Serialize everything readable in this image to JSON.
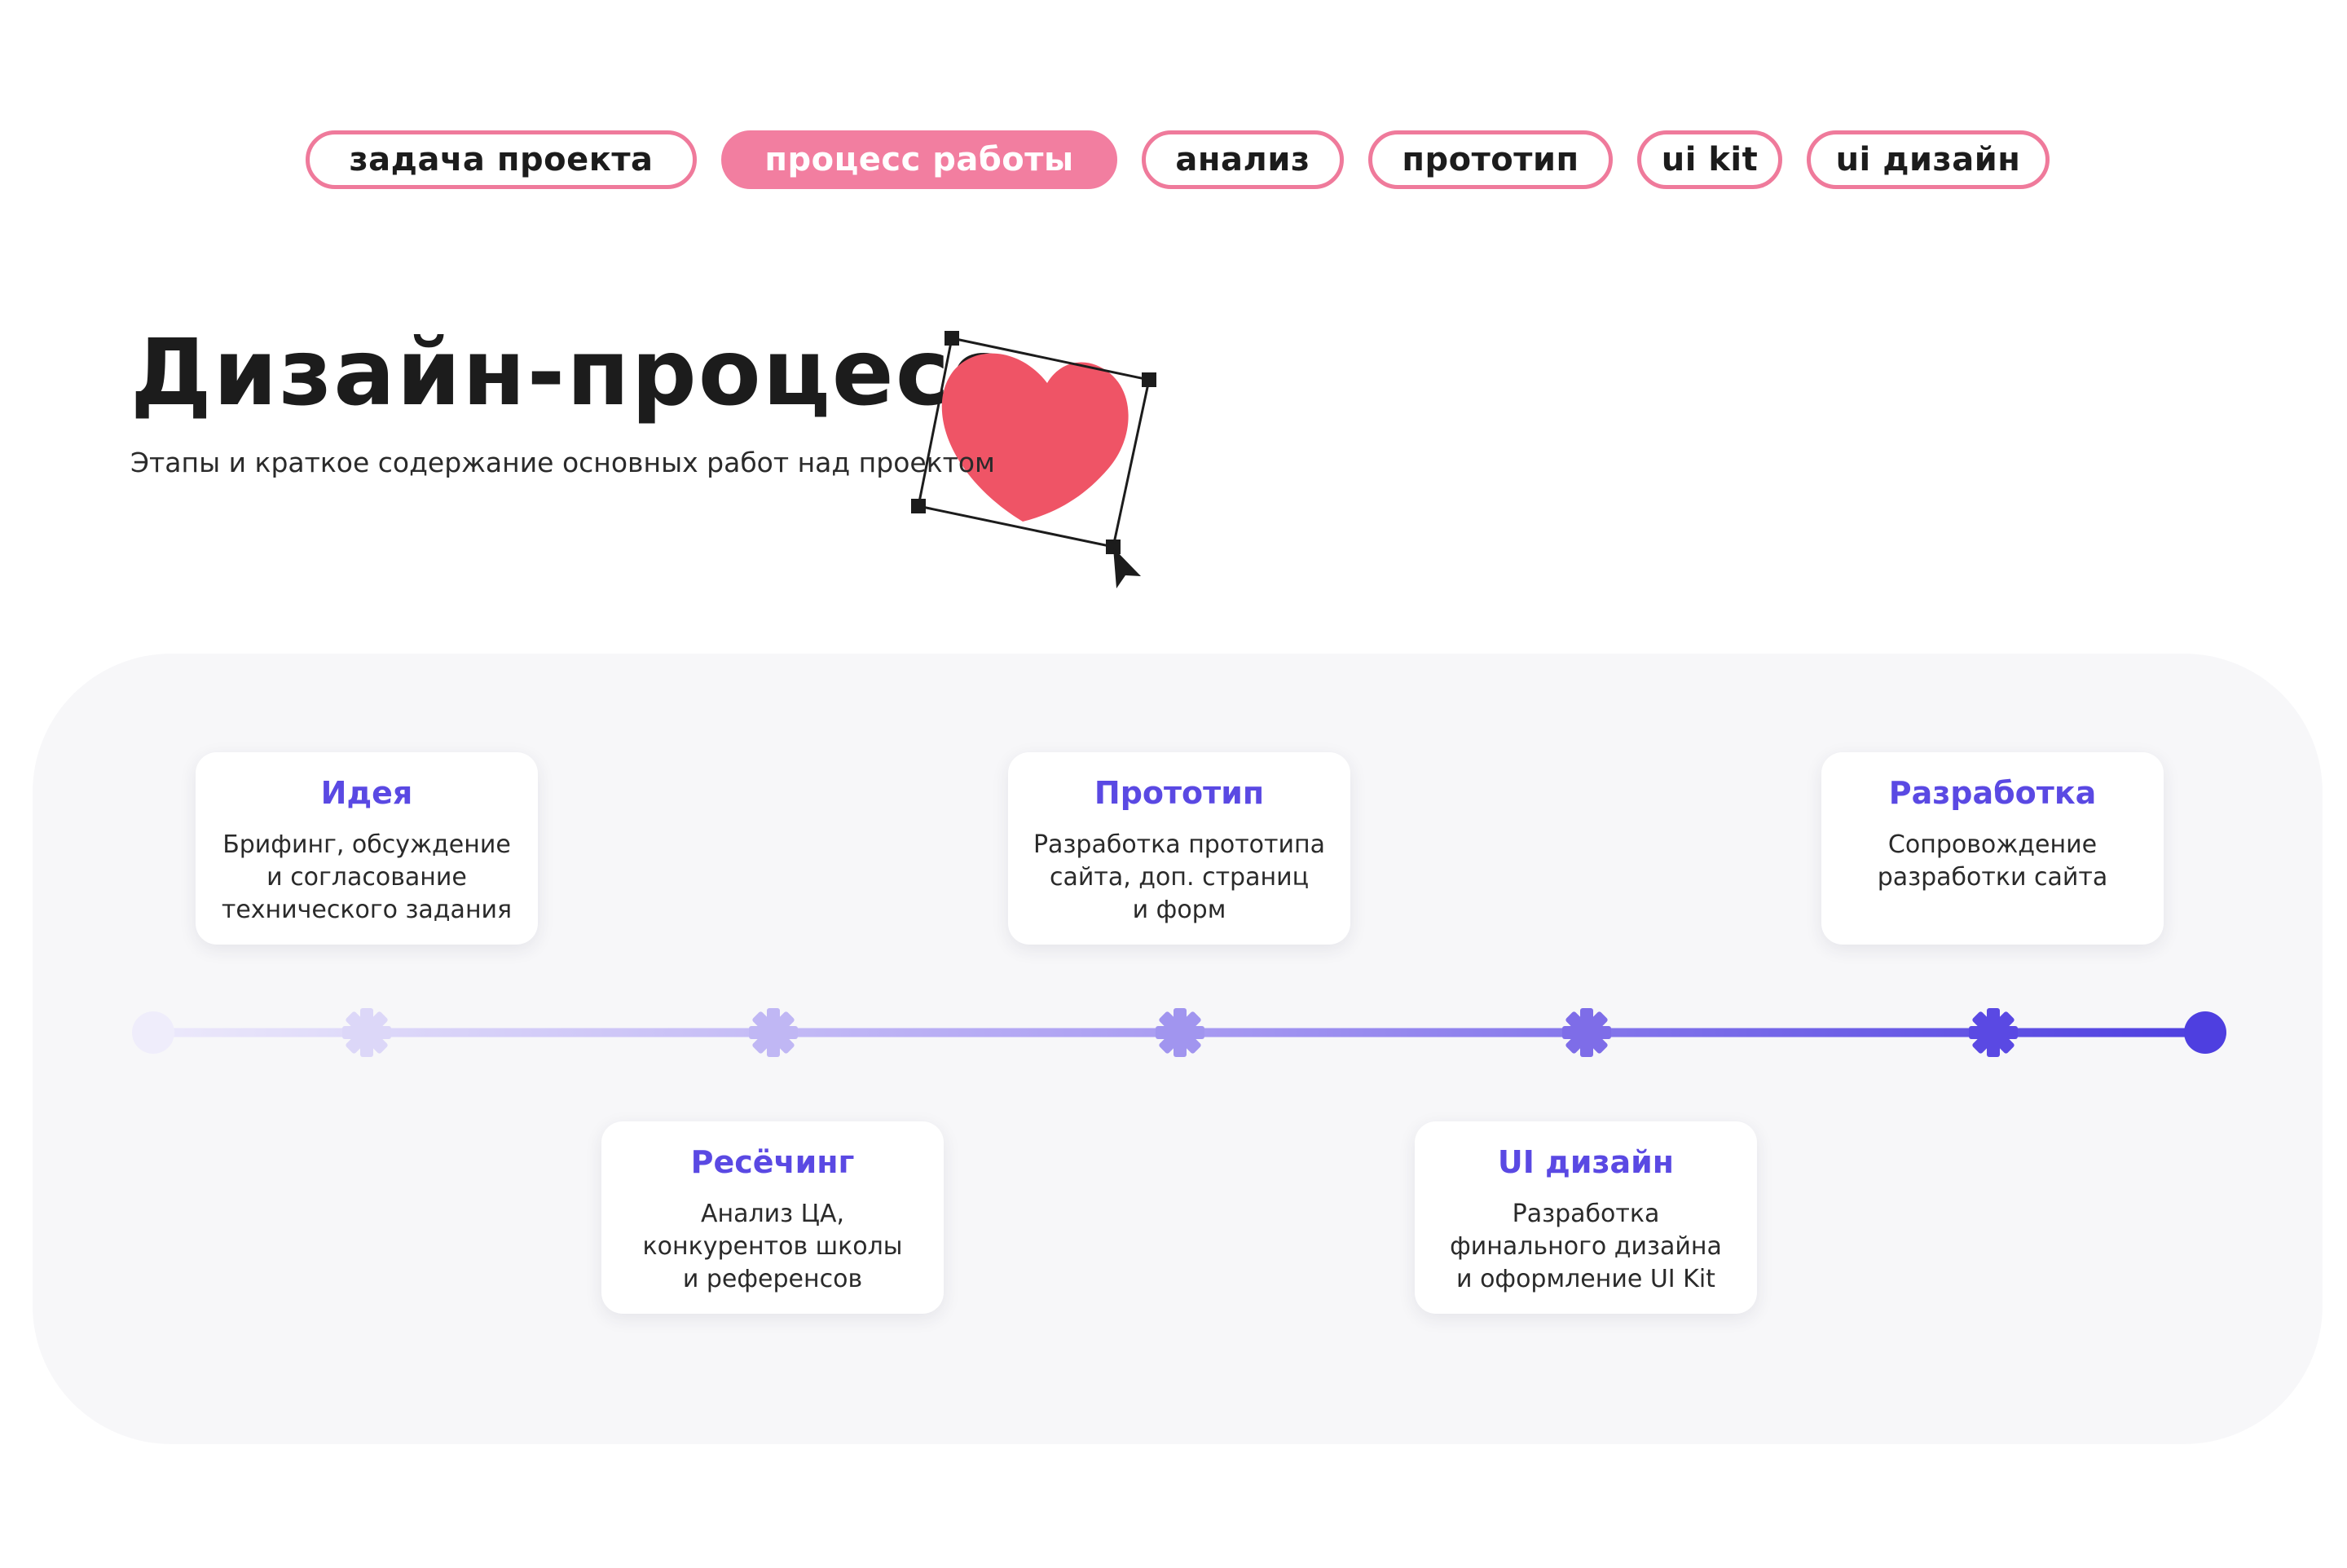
{
  "nav": {
    "items": [
      {
        "label": "задача проекта"
      },
      {
        "label": "процесс работы"
      },
      {
        "label": "анализ"
      },
      {
        "label": "прототип"
      },
      {
        "label": "ui kit"
      },
      {
        "label": "ui дизайн"
      }
    ],
    "active_index": 1
  },
  "header": {
    "title": "Дизайн-процесс",
    "subtitle": "Этапы и краткое содержание основных работ над проектом"
  },
  "stages": [
    {
      "title": "Идея",
      "lines": [
        "Брифинг, обсуждение",
        "и согласование",
        "технического задания"
      ]
    },
    {
      "title": "Ресёчинг",
      "lines": [
        "Анализ ЦА,",
        "конкурентов школы",
        "и референсов"
      ]
    },
    {
      "title": "Прототип",
      "lines": [
        "Разработка прототипа",
        "сайта, доп. страниц",
        "и форм"
      ]
    },
    {
      "title": "UI дизайн",
      "lines": [
        "Разработка",
        "финального дизайна",
        "и оформление UI Kit"
      ]
    },
    {
      "title": "Разработка",
      "lines": [
        "Сопровождение",
        "разработки сайта"
      ]
    }
  ],
  "colors": {
    "accent_pink": "#f27ea0",
    "heart": "#ef5466",
    "stage_title": "#5a49e3",
    "timeline_start": "#ece9fb",
    "timeline_end": "#4e3fe0"
  },
  "icons": {
    "decoration": "heart-icon",
    "cursor": "cursor-arrow-icon",
    "timeline_markers": "gear-marker-icon"
  }
}
